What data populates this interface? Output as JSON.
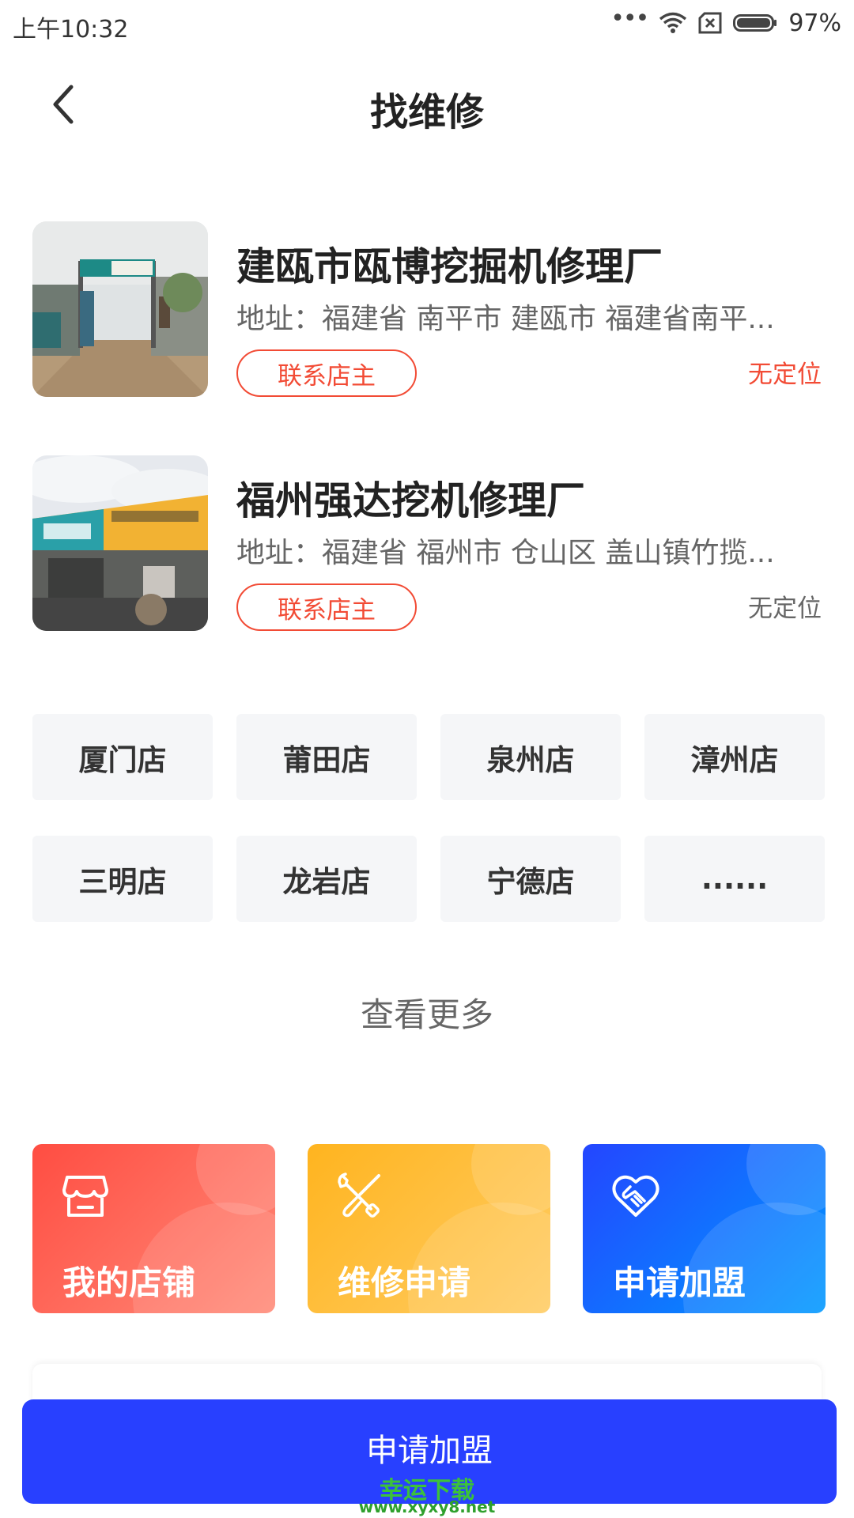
{
  "status_bar": {
    "time": "上午10:32",
    "dots": "•••",
    "battery_text": "97%",
    "icons": [
      "wifi-icon",
      "sim-off-icon",
      "battery-icon"
    ]
  },
  "nav": {
    "title": "找维修",
    "back_icon": "chevron-left-icon"
  },
  "shops": [
    {
      "name": "建瓯市瓯博挖掘机修理厂",
      "address": "地址：福建省 南平市 建瓯市 福建省南平...",
      "contact_label": "联系店主",
      "location": "无定位",
      "location_color": "#f24b35"
    },
    {
      "name": "福州强达挖机修理厂",
      "address": "地址：福建省 福州市 仓山区 盖山镇竹揽...",
      "contact_label": "联系店主",
      "location": "无定位",
      "location_color": "#666666"
    }
  ],
  "cities": [
    "厦门店",
    "莆田店",
    "泉州店",
    "漳州店",
    "三明店",
    "龙岩店",
    "宁德店",
    "......"
  ],
  "view_more": "查看更多",
  "features": [
    {
      "label": "我的店铺",
      "icon": "store-icon",
      "colors": [
        "#ff4d42",
        "#ff8a78"
      ]
    },
    {
      "label": "维修申请",
      "icon": "tools-icon",
      "colors": [
        "#ffb41f",
        "#ffcc63"
      ]
    },
    {
      "label": "申请加盟",
      "icon": "handshake-heart-icon",
      "colors": [
        "#2446ff",
        "#0099ff"
      ]
    }
  ],
  "join_button": {
    "label": "申请加盟"
  },
  "watermark": {
    "cn": "幸运下载",
    "url": "www.xyxy8.net"
  }
}
